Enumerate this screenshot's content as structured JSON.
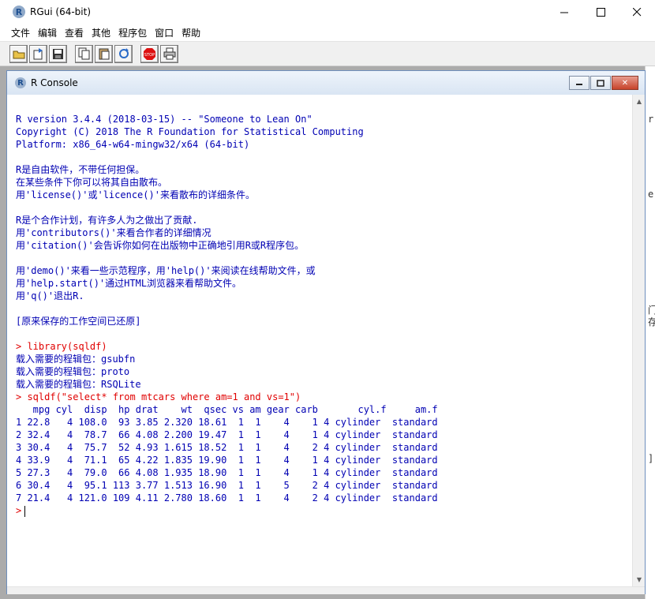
{
  "window": {
    "title": "RGui (64-bit)",
    "icon": "r-logo-icon",
    "controls": [
      "minimize",
      "maximize",
      "close"
    ]
  },
  "menubar": [
    "文件",
    "编辑",
    "查看",
    "其他",
    "程序包",
    "窗口",
    "帮助"
  ],
  "toolbar": {
    "buttons": [
      "open-script",
      "load-workspace",
      "save-workspace",
      "copy",
      "paste",
      "copy-paste",
      "stop",
      "print"
    ]
  },
  "console": {
    "title": "R Console",
    "lines": [
      {
        "t": "R version 3.4.4 (2018-03-15) -- \"Someone to Lean On\"",
        "c": "blue"
      },
      {
        "t": "Copyright (C) 2018 The R Foundation for Statistical Computing",
        "c": "blue"
      },
      {
        "t": "Platform: x86_64-w64-mingw32/x64 (64-bit)",
        "c": "blue"
      },
      {
        "t": "",
        "c": "blue"
      },
      {
        "t": "R是自由软件，不带任何担保。",
        "c": "blue"
      },
      {
        "t": "在某些条件下你可以将其自由散布。",
        "c": "blue"
      },
      {
        "t": "用'license()'或'licence()'来看散布的详细条件。",
        "c": "blue"
      },
      {
        "t": "",
        "c": "blue"
      },
      {
        "t": "R是个合作计划，有许多人为之做出了贡献.",
        "c": "blue"
      },
      {
        "t": "用'contributors()'来看合作者的详细情况",
        "c": "blue"
      },
      {
        "t": "用'citation()'会告诉你如何在出版物中正确地引用R或R程序包。",
        "c": "blue"
      },
      {
        "t": "",
        "c": "blue"
      },
      {
        "t": "用'demo()'来看一些示范程序，用'help()'来阅读在线帮助文件，或",
        "c": "blue"
      },
      {
        "t": "用'help.start()'通过HTML浏览器来看帮助文件。",
        "c": "blue"
      },
      {
        "t": "用'q()'退出R.",
        "c": "blue"
      },
      {
        "t": "",
        "c": "blue"
      },
      {
        "t": "[原来保存的工作空间已还原]",
        "c": "blue"
      },
      {
        "t": "",
        "c": "blue"
      },
      {
        "t": "> library(sqldf)",
        "c": "red"
      },
      {
        "t": "载入需要的程辑包：gsubfn",
        "c": "blue"
      },
      {
        "t": "载入需要的程辑包：proto",
        "c": "blue"
      },
      {
        "t": "载入需要的程辑包：RSQLite",
        "c": "blue"
      },
      {
        "t": "> sqldf(\"select* from mtcars where am=1 and vs=1\")",
        "c": "red"
      },
      {
        "t": "   mpg cyl  disp  hp drat    wt  qsec vs am gear carb       cyl.f     am.f",
        "c": "blue"
      },
      {
        "t": "1 22.8   4 108.0  93 3.85 2.320 18.61  1  1    4    1 4 cylinder  standard",
        "c": "blue"
      },
      {
        "t": "2 32.4   4  78.7  66 4.08 2.200 19.47  1  1    4    1 4 cylinder  standard",
        "c": "blue"
      },
      {
        "t": "3 30.4   4  75.7  52 4.93 1.615 18.52  1  1    4    2 4 cylinder  standard",
        "c": "blue"
      },
      {
        "t": "4 33.9   4  71.1  65 4.22 1.835 19.90  1  1    4    1 4 cylinder  standard",
        "c": "blue"
      },
      {
        "t": "5 27.3   4  79.0  66 4.08 1.935 18.90  1  1    4    1 4 cylinder  standard",
        "c": "blue"
      },
      {
        "t": "6 30.4   4  95.1 113 3.77 1.513 16.90  1  1    5    2 4 cylinder  standard",
        "c": "blue"
      },
      {
        "t": "7 21.4   4 121.0 109 4.11 2.780 18.60  1  1    4    2 4 cylinder  standard",
        "c": "blue"
      }
    ],
    "prompt": ">"
  },
  "background_strip": [
    "r",
    "e",
    "门",
    "存",
    "]"
  ],
  "colors": {
    "console_text": "#0000b3",
    "command_text": "#e00000",
    "mdi_background": "#ababab"
  }
}
